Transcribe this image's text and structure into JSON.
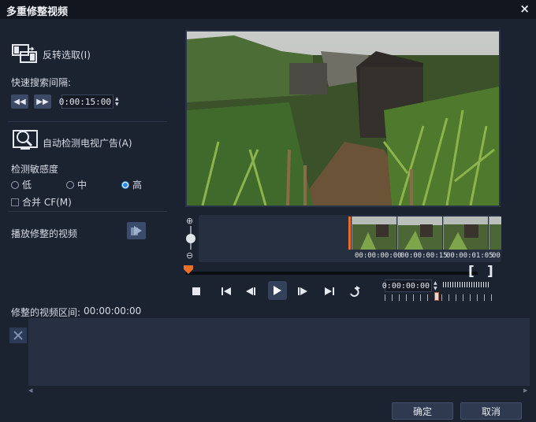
{
  "window": {
    "title": "多重修整视频",
    "close_glyph": "×"
  },
  "left": {
    "invert_label": "反转选取(I)",
    "quick_search_label": "快速搜索间隔:",
    "quick_search_value": "0:00:15:00",
    "auto_detect_label": "自动检测电视广告(A)",
    "sensitivity_label": "检测敏感度",
    "sensitivity_options": [
      "低",
      "中",
      "高"
    ],
    "sensitivity_selected": "高",
    "merge_cf_label": "合并 CF(M)",
    "play_trimmed_label": "播放修整的视频"
  },
  "timeline": {
    "zoom_in_glyph": "⊕",
    "zoom_out_glyph": "⊖",
    "thumb_times": [
      "00:00:00:00",
      "00:00:00:15",
      "00:00:01:05",
      "00"
    ],
    "mark_in": "[",
    "mark_out": "]",
    "timecode": "0:00:00:00"
  },
  "range": {
    "label": "修整的视频区间:",
    "value": "00:00:00:00"
  },
  "footer": {
    "ok_label": "确定",
    "cancel_label": "取消"
  },
  "colors": {
    "accent": "#2f8de8",
    "playhead": "#e8702a",
    "background": "#1b2230"
  }
}
